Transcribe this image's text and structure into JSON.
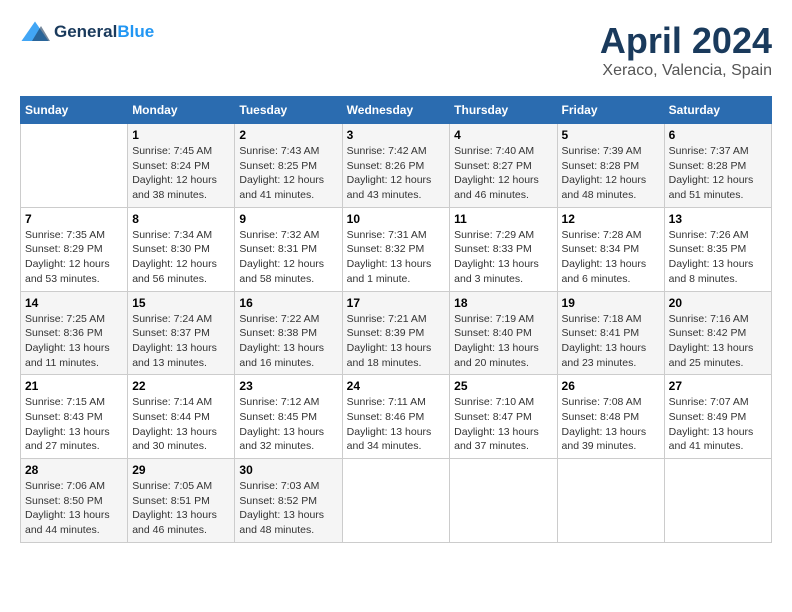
{
  "header": {
    "logo": {
      "general": "General",
      "blue": "Blue"
    },
    "title": "April 2024",
    "location": "Xeraco, Valencia, Spain"
  },
  "calendar": {
    "weekdays": [
      "Sunday",
      "Monday",
      "Tuesday",
      "Wednesday",
      "Thursday",
      "Friday",
      "Saturday"
    ],
    "weeks": [
      [
        {
          "day": "",
          "info": ""
        },
        {
          "day": "1",
          "info": "Sunrise: 7:45 AM\nSunset: 8:24 PM\nDaylight: 12 hours\nand 38 minutes."
        },
        {
          "day": "2",
          "info": "Sunrise: 7:43 AM\nSunset: 8:25 PM\nDaylight: 12 hours\nand 41 minutes."
        },
        {
          "day": "3",
          "info": "Sunrise: 7:42 AM\nSunset: 8:26 PM\nDaylight: 12 hours\nand 43 minutes."
        },
        {
          "day": "4",
          "info": "Sunrise: 7:40 AM\nSunset: 8:27 PM\nDaylight: 12 hours\nand 46 minutes."
        },
        {
          "day": "5",
          "info": "Sunrise: 7:39 AM\nSunset: 8:28 PM\nDaylight: 12 hours\nand 48 minutes."
        },
        {
          "day": "6",
          "info": "Sunrise: 7:37 AM\nSunset: 8:28 PM\nDaylight: 12 hours\nand 51 minutes."
        }
      ],
      [
        {
          "day": "7",
          "info": "Sunrise: 7:35 AM\nSunset: 8:29 PM\nDaylight: 12 hours\nand 53 minutes."
        },
        {
          "day": "8",
          "info": "Sunrise: 7:34 AM\nSunset: 8:30 PM\nDaylight: 12 hours\nand 56 minutes."
        },
        {
          "day": "9",
          "info": "Sunrise: 7:32 AM\nSunset: 8:31 PM\nDaylight: 12 hours\nand 58 minutes."
        },
        {
          "day": "10",
          "info": "Sunrise: 7:31 AM\nSunset: 8:32 PM\nDaylight: 13 hours\nand 1 minute."
        },
        {
          "day": "11",
          "info": "Sunrise: 7:29 AM\nSunset: 8:33 PM\nDaylight: 13 hours\nand 3 minutes."
        },
        {
          "day": "12",
          "info": "Sunrise: 7:28 AM\nSunset: 8:34 PM\nDaylight: 13 hours\nand 6 minutes."
        },
        {
          "day": "13",
          "info": "Sunrise: 7:26 AM\nSunset: 8:35 PM\nDaylight: 13 hours\nand 8 minutes."
        }
      ],
      [
        {
          "day": "14",
          "info": "Sunrise: 7:25 AM\nSunset: 8:36 PM\nDaylight: 13 hours\nand 11 minutes."
        },
        {
          "day": "15",
          "info": "Sunrise: 7:24 AM\nSunset: 8:37 PM\nDaylight: 13 hours\nand 13 minutes."
        },
        {
          "day": "16",
          "info": "Sunrise: 7:22 AM\nSunset: 8:38 PM\nDaylight: 13 hours\nand 16 minutes."
        },
        {
          "day": "17",
          "info": "Sunrise: 7:21 AM\nSunset: 8:39 PM\nDaylight: 13 hours\nand 18 minutes."
        },
        {
          "day": "18",
          "info": "Sunrise: 7:19 AM\nSunset: 8:40 PM\nDaylight: 13 hours\nand 20 minutes."
        },
        {
          "day": "19",
          "info": "Sunrise: 7:18 AM\nSunset: 8:41 PM\nDaylight: 13 hours\nand 23 minutes."
        },
        {
          "day": "20",
          "info": "Sunrise: 7:16 AM\nSunset: 8:42 PM\nDaylight: 13 hours\nand 25 minutes."
        }
      ],
      [
        {
          "day": "21",
          "info": "Sunrise: 7:15 AM\nSunset: 8:43 PM\nDaylight: 13 hours\nand 27 minutes."
        },
        {
          "day": "22",
          "info": "Sunrise: 7:14 AM\nSunset: 8:44 PM\nDaylight: 13 hours\nand 30 minutes."
        },
        {
          "day": "23",
          "info": "Sunrise: 7:12 AM\nSunset: 8:45 PM\nDaylight: 13 hours\nand 32 minutes."
        },
        {
          "day": "24",
          "info": "Sunrise: 7:11 AM\nSunset: 8:46 PM\nDaylight: 13 hours\nand 34 minutes."
        },
        {
          "day": "25",
          "info": "Sunrise: 7:10 AM\nSunset: 8:47 PM\nDaylight: 13 hours\nand 37 minutes."
        },
        {
          "day": "26",
          "info": "Sunrise: 7:08 AM\nSunset: 8:48 PM\nDaylight: 13 hours\nand 39 minutes."
        },
        {
          "day": "27",
          "info": "Sunrise: 7:07 AM\nSunset: 8:49 PM\nDaylight: 13 hours\nand 41 minutes."
        }
      ],
      [
        {
          "day": "28",
          "info": "Sunrise: 7:06 AM\nSunset: 8:50 PM\nDaylight: 13 hours\nand 44 minutes."
        },
        {
          "day": "29",
          "info": "Sunrise: 7:05 AM\nSunset: 8:51 PM\nDaylight: 13 hours\nand 46 minutes."
        },
        {
          "day": "30",
          "info": "Sunrise: 7:03 AM\nSunset: 8:52 PM\nDaylight: 13 hours\nand 48 minutes."
        },
        {
          "day": "",
          "info": ""
        },
        {
          "day": "",
          "info": ""
        },
        {
          "day": "",
          "info": ""
        },
        {
          "day": "",
          "info": ""
        }
      ]
    ]
  }
}
